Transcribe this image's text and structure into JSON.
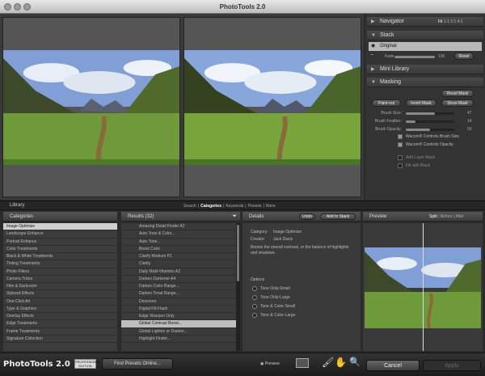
{
  "window": {
    "title": "PhotoTools 2.0"
  },
  "right_panel": {
    "navigator": {
      "label": "Navigator",
      "zoom_options": [
        "Fit",
        "1:1",
        "2:1",
        "4:1"
      ]
    },
    "stack": {
      "label": "Stack",
      "original_label": "Original",
      "fade_label": "Fade",
      "fade_value": "100",
      "reset_label": "Reset"
    },
    "mini_library": {
      "label": "Mini Library"
    },
    "masking": {
      "label": "Masking",
      "reset_mask": "Reset Mask",
      "paint_out": "Paint-out",
      "invert_mask": "Invert Mask",
      "show_mask": "Show Mask",
      "sliders": [
        {
          "label": "Brush Size:",
          "value": "47",
          "level": 0.6
        },
        {
          "label": "Brush Feather:",
          "value": "14",
          "level": 0.2
        },
        {
          "label": "Brush Opacity:",
          "value": "50",
          "level": 0.5
        }
      ],
      "checks": [
        {
          "label": "Wacom® Controls Brush Size",
          "checked": true
        },
        {
          "label": "Wacom® Controls Opacity",
          "checked": true
        },
        {
          "label": "Add Layer Mask",
          "checked": false
        },
        {
          "label": "Fill with Black",
          "checked": false
        }
      ]
    }
  },
  "library": {
    "title": "Library",
    "tabs": [
      "Search",
      "Categories",
      "Keywords",
      "Presets",
      "None"
    ],
    "active_tab": "Categories"
  },
  "columns": {
    "categories": "Categories",
    "results": "Results (32)",
    "details": "Details",
    "preview": "Preview"
  },
  "categories": [
    "Image Optimize",
    "Landscape Enhance",
    "Portrait Enhance",
    "Color Treatments",
    "Black & White Treatments",
    "Tinting Treatments",
    "Photo Filters",
    "Camera Tricks",
    "Film & Darkroom",
    "Stylized Effects",
    "One-Click Art",
    "Type & Graphics",
    "Overlay Effects",
    "Edge Treatments",
    "Frame Treatments",
    "Signature Collection"
  ],
  "results": [
    "Amazing Detail Finder A2",
    "Auto Tone & Color...",
    "Auto Tone...",
    "Boost Color",
    "Clarify Medium P1",
    "Clarity",
    "Daily Multi-Vitamins A2",
    "Darken Darkener A4",
    "Darken Color Range...",
    "Darken Tonal Range...",
    "Descreen",
    "Digital Fill Flash",
    "Edge Sharpen Only",
    "Global Contrast Boost...",
    "Global Lighten or Darken...",
    "Highlight Finder..."
  ],
  "details": {
    "undo_label": "Undo",
    "add_label": "Add to Stack",
    "category_label": "Category:",
    "category_value": "Image Optimize",
    "creator_label": "Creator:",
    "creator_value": "Jack Davis",
    "description": "Boosts the overall contrast, or the balance of highlights and shadows.",
    "options_label": "Options",
    "options": [
      "Tone Only-Small",
      "Tone Only-Large",
      "Tone & Color-Small",
      "Tone & Color-Large"
    ]
  },
  "preview": {
    "modes": [
      "Split",
      "Before",
      "After"
    ]
  },
  "bottom": {
    "logo": "PhotoTools 2.0",
    "edition": "PROFESSIONAL EDITION",
    "find_presets": "Find Presets Online...",
    "preview_label": "Preview",
    "cancel": "Cancel",
    "apply": "Apply"
  },
  "colors": {
    "selection": "#cfcfcf",
    "panel": "#333333",
    "sky": "#7f9fd6",
    "grass": "#6f9a3a"
  }
}
